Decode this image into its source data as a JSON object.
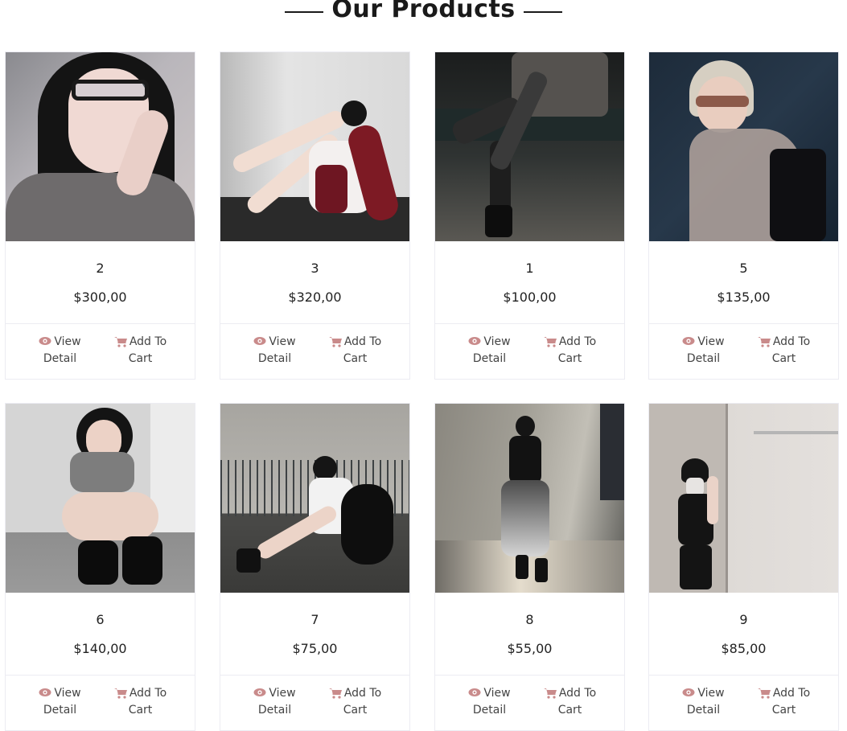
{
  "section": {
    "title": "Our Products"
  },
  "actions": {
    "view_line1": "View",
    "view_line2": "Detail",
    "cart_line1": "Add To",
    "cart_line2": "Cart"
  },
  "icons": {
    "view": "eye-icon",
    "cart": "cart-icon"
  },
  "colors": {
    "accent": "#c98b8b",
    "border": "#ececf2",
    "text": "#222222"
  },
  "products": [
    {
      "name": "2",
      "price": "$300,00"
    },
    {
      "name": "3",
      "price": "$320,00"
    },
    {
      "name": "1",
      "price": "$100,00"
    },
    {
      "name": "5",
      "price": "$135,00"
    },
    {
      "name": "6",
      "price": "$140,00"
    },
    {
      "name": "7",
      "price": "$75,00"
    },
    {
      "name": "8",
      "price": "$55,00"
    },
    {
      "name": "9",
      "price": "$85,00"
    }
  ]
}
